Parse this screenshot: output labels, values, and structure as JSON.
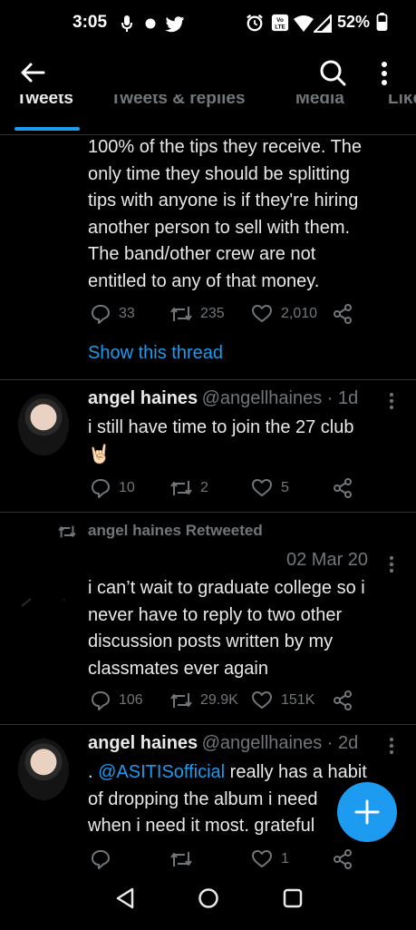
{
  "status_bar": {
    "time": "3:05",
    "battery": "52%",
    "icons": [
      "mic-icon",
      "dot-icon",
      "twitter-icon",
      "alarm-icon",
      "volte-icon",
      "wifi-icon",
      "signal-icon",
      "battery-icon"
    ]
  },
  "app_bar": {
    "icons": [
      "back-arrow-icon",
      "search-icon",
      "more-vert-icon"
    ]
  },
  "tabs": [
    {
      "label": "Tweets"
    },
    {
      "label": "Tweets & replies"
    },
    {
      "label": "Media"
    },
    {
      "label": "Likes"
    }
  ],
  "tweets": [
    {
      "text_lines": [
        "100% of the tips they receive. The",
        "only time they should be splitting",
        "tips with anyone is if they're hiring",
        "another person to sell with them.",
        "The band/other crew are not",
        "entitled to any of that money."
      ],
      "replies": "33",
      "retweets": "235",
      "likes": "2,010",
      "show_thread": "Show this thread"
    },
    {
      "name": "angel haines",
      "handle": "@angellhaines · 1d",
      "text_lines": [
        "i still have time to join the 27 club"
      ],
      "emoji": "🤘🏻",
      "replies": "10",
      "retweets": "2",
      "likes": "5"
    },
    {
      "retweeted_by": "angel haines Retweeted",
      "date": "02 Mar 20",
      "text_lines": [
        "i can’t wait to graduate college so i",
        "never have to reply to two other",
        "discussion posts written by my",
        "classmates ever again"
      ],
      "replies": "106",
      "retweets": "29.9K",
      "likes": "151K"
    },
    {
      "name": "angel haines",
      "handle": "@angellhaines · 2d",
      "mention_prefix": ". ",
      "mention": "@ASITISofficial",
      "text_line1_rest": " really has a habit",
      "text_lines": [
        "of dropping the album i need",
        "when i need it most. grateful"
      ],
      "likes": "1"
    }
  ],
  "colors": {
    "background": "#000000",
    "accent": "#1d9bf0",
    "text": "#e7e9ea",
    "muted": "#71767b",
    "divider": "#2f3336"
  }
}
